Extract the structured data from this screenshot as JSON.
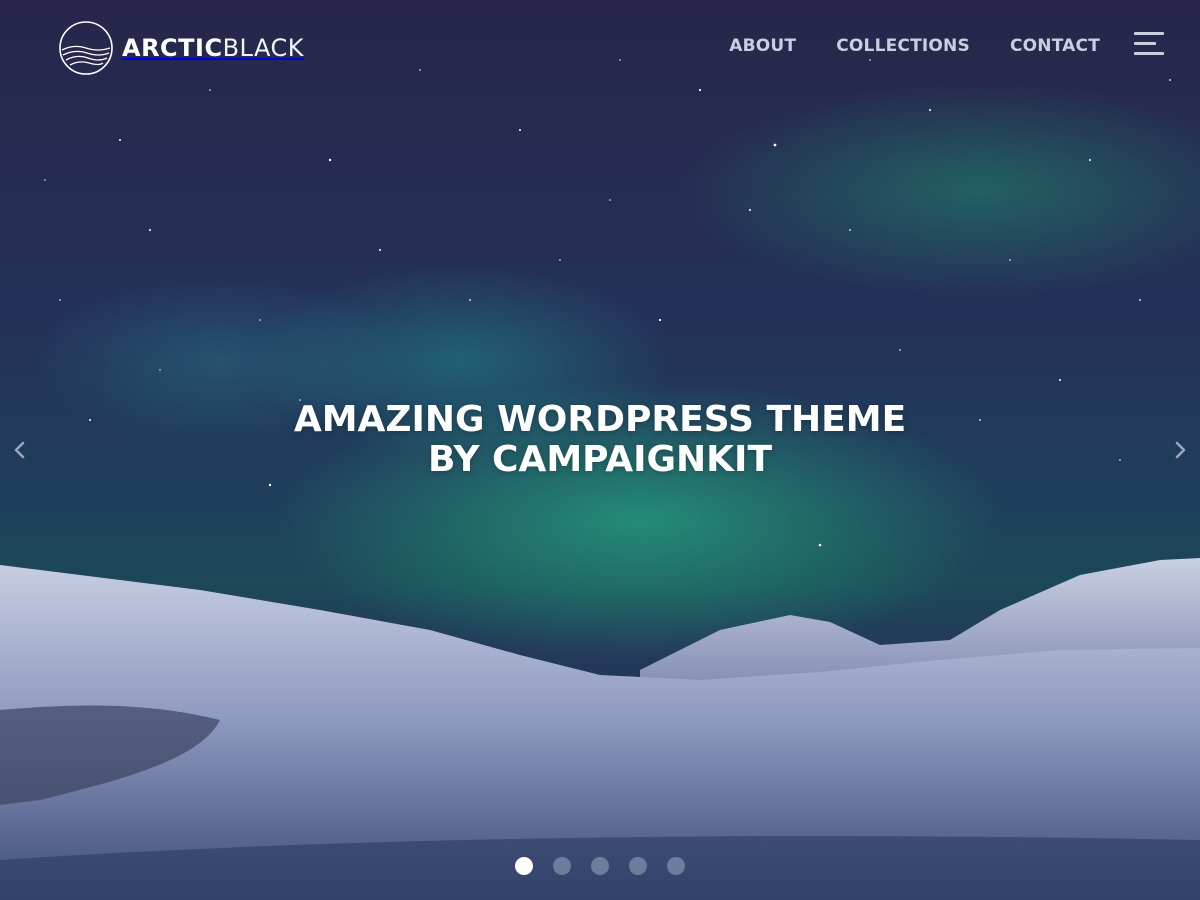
{
  "brand": {
    "name_bold": "ARCTIC",
    "name_light": "BLACK",
    "logo_icon": "wave-circle-logo-icon"
  },
  "nav": {
    "items": [
      {
        "label": "ABOUT"
      },
      {
        "label": "COLLECTIONS"
      },
      {
        "label": "CONTACT"
      }
    ],
    "menu_icon": "hamburger-menu-icon"
  },
  "hero": {
    "headline_line1": "AMAZING WORDPRESS THEME",
    "headline_line2": "BY CAMPAIGNKIT",
    "prev_icon": "chevron-left-icon",
    "next_icon": "chevron-right-icon"
  },
  "slider": {
    "slide_count": 5,
    "active_index": 0
  },
  "colors": {
    "nav_text": "#c6d0de",
    "headline": "#ffffff",
    "aurora_green": "#1fa07a",
    "sky": "#27264a"
  }
}
